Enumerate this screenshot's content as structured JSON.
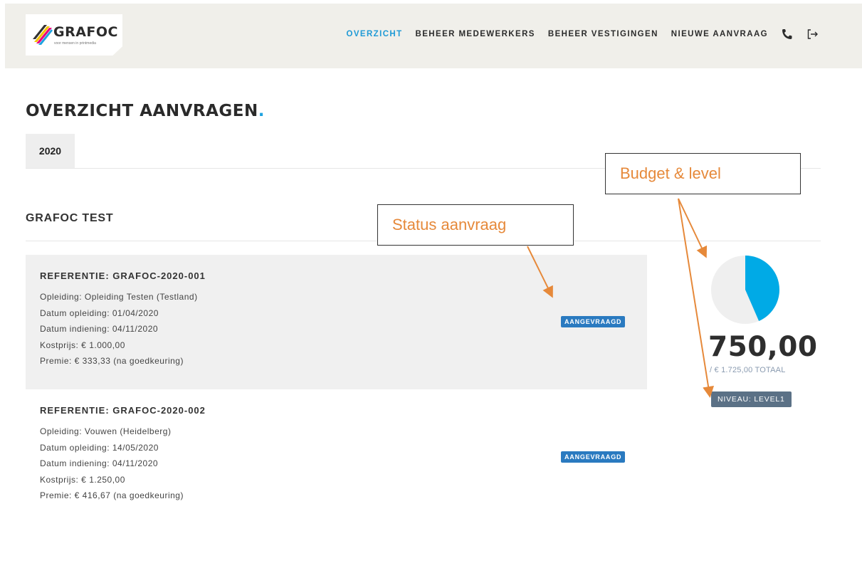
{
  "header": {
    "logo_text": "GRAFOC",
    "logo_tagline": "voor mensen in printmedia",
    "nav": [
      {
        "label": "OVERZICHT",
        "active": true
      },
      {
        "label": "BEHEER MEDEWERKERS",
        "active": false
      },
      {
        "label": "BEHEER VESTIGINGEN",
        "active": false
      },
      {
        "label": "NIEUWE AANVRAAG",
        "active": false
      }
    ],
    "icons": [
      "phone-icon",
      "logout-icon"
    ]
  },
  "page": {
    "title": "OVERZICHT AANVRAGEN",
    "title_dot": ".",
    "year_tab": "2020",
    "company": "GRAFOC TEST"
  },
  "requests": [
    {
      "reference": "REFERENTIE: GRAFOC-2020-001",
      "lines": [
        "Opleiding: Opleiding Testen (Testland)",
        "Datum opleiding: 01/04/2020",
        "Datum indiening: 04/11/2020",
        "Kostprijs: € 1.000,00",
        "Premie: € 333,33 (na goedkeuring)"
      ],
      "status": "AANGEVRAAGD"
    },
    {
      "reference": "REFERENTIE: GRAFOC-2020-002",
      "lines": [
        "Opleiding: Vouwen (Heidelberg)",
        "Datum opleiding: 14/05/2020",
        "Datum indiening: 04/11/2020",
        "Kostprijs: € 1.250,00",
        "Premie: € 416,67 (na goedkeuring)"
      ],
      "status": "AANGEVRAAGD"
    }
  ],
  "budget": {
    "amount": "750,00",
    "total": "/ € 1.725,00 TOTAAL",
    "used_fraction": 0.4348,
    "level": "NIVEAU: LEVEL1",
    "pie_fill_color": "#00aae6",
    "pie_empty_color": "#efefef"
  },
  "annotations": {
    "status": "Status aanvraag",
    "budget": "Budget & level",
    "color": "#e6893a"
  },
  "colors": {
    "accent": "#1f9ad6",
    "badge": "#2a7ac0",
    "level": "#5b7186"
  }
}
